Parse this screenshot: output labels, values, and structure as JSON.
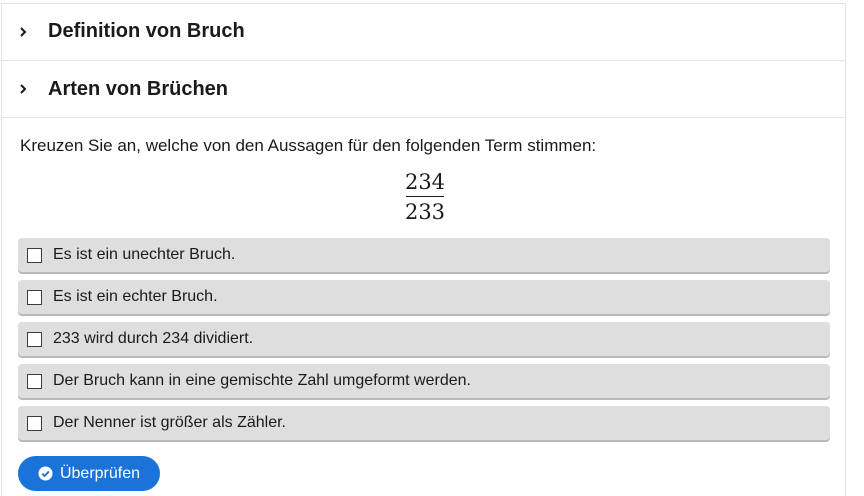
{
  "accordion": [
    {
      "title": "Definition von Bruch",
      "icon": "chevron-right-icon"
    },
    {
      "title": "Arten von Brüchen",
      "icon": "chevron-right-icon"
    }
  ],
  "task": {
    "prompt": "Kreuzen Sie an, welche von den Aussagen für den folgenden Term stimmen:",
    "fraction": {
      "numerator": "234",
      "denominator": "233"
    }
  },
  "options": [
    {
      "label": "Es ist ein unechter Bruch.",
      "checked": false
    },
    {
      "label": "Es ist ein echter Bruch.",
      "checked": false
    },
    {
      "label": "233 wird durch 234 dividiert.",
      "checked": false
    },
    {
      "label": "Der Bruch kann in eine gemischte Zahl umgeformt werden.",
      "checked": false
    },
    {
      "label": "Der Nenner ist größer als Zähler.",
      "checked": false
    }
  ],
  "check_button": {
    "label": "Überprüfen",
    "icon": "check-circle-icon"
  },
  "colors": {
    "primary": "#1a73d9",
    "option_bg": "#dedede",
    "text": "#1a1a1a"
  }
}
